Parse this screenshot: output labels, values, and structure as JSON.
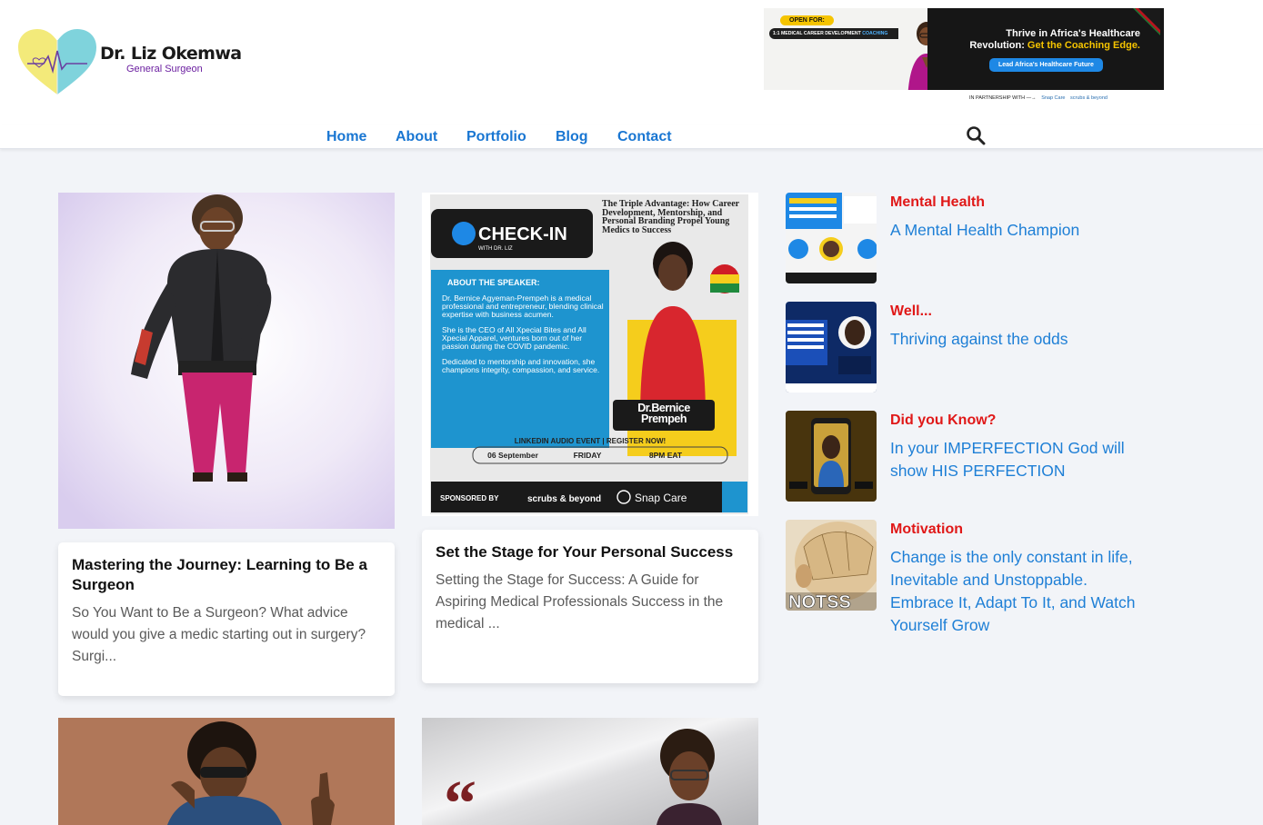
{
  "site": {
    "name": "Dr. Liz Okemwa",
    "subtitle": "General Surgeon"
  },
  "banner": {
    "open_for": "OPEN FOR:",
    "coaching_prefix": "1:1 MEDICAL CAREER DEVELOPMENT ",
    "coaching_highlight": "COACHING",
    "title_line1": "Thrive in Africa's Healthcare",
    "title_line2a": "Revolution: ",
    "title_line2b": "Get the Coaching Edge.",
    "cta": "Lead Africa's Healthcare Future",
    "partnership": "IN PARTNERSHIP WITH —→",
    "partner1": "Snap Care",
    "partner2": "scrubs & beyond",
    "colors": {
      "dark": "#161616",
      "yellow": "#f5c400",
      "blue": "#1e88e5"
    }
  },
  "nav": {
    "items": [
      "Home",
      "About",
      "Portfolio",
      "Blog",
      "Contact"
    ],
    "search_icon": "search-icon",
    "color": "#1976d2"
  },
  "posts": [
    {
      "title": "Mastering the Journey: Learning to Be a Surgeon",
      "excerpt": "So You Want to Be a Surgeon? What advice would you give a medic starting out in surgery? Surgi..."
    },
    {
      "title": "Set the Stage for Your Personal Success",
      "excerpt": "Setting the Stage for Success: A Guide for Aspiring Medical Professionals Success in the medical ..."
    }
  ],
  "poster": {
    "brand": "CHECK-IN",
    "brand_sub": "WITH DR. LIZ",
    "headline": "The Triple Advantage: How Career Development, Mentorship, and Personal Branding Propel Young Medics to Success",
    "about_heading": "ABOUT THE SPEAKER:",
    "about_p1": "Dr. Bernice Agyeman-Prempeh is a medical professional and entrepreneur, blending clinical expertise with business acumen.",
    "about_p2": "She is the CEO of All Xpecial Bites and All Xpecial Apparel, ventures born out of her passion during the COVID pandemic.",
    "about_p3": "Dedicated to mentorship and innovation, she champions integrity, compassion, and service.",
    "speaker": "Dr.Bernice Prempeh",
    "event": "LINKEDIN AUDIO EVENT | REGISTER NOW!",
    "date": "06 September",
    "day": "FRIDAY",
    "time": "8PM EAT",
    "sponsored_by": "SPONSORED BY",
    "sponsor1": "scrubs & beyond",
    "sponsor2": "Snap Care"
  },
  "quote_mark": "“",
  "sidebar": [
    {
      "category": "Mental Health",
      "title": "A Mental Health Champion"
    },
    {
      "category": "Well...",
      "title": "Thriving against the odds"
    },
    {
      "category": "Did you Know?",
      "title": "In your IMPERFECTION God will show HIS PERFECTION"
    },
    {
      "category": "Motivation",
      "title": "Change is the only constant in life, Inevitable and Unstoppable. Embrace It, Adapt To It, and Watch Yourself Grow",
      "thumb_text": "NOTSS"
    }
  ],
  "colors": {
    "link": "#1e7fd6",
    "category": "#e01818",
    "page_bg": "#f2f4f8"
  }
}
